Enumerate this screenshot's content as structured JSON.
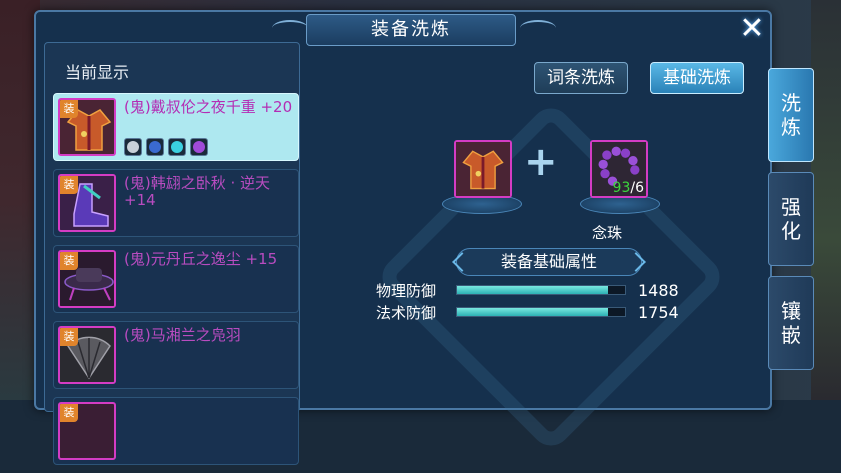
{
  "window": {
    "title": "装备洗炼",
    "close_label": "✕"
  },
  "left_panel": {
    "heading": "当前显示",
    "items": [
      {
        "name": "(鬼)戴叔伦之夜千重 +20",
        "badge": "装",
        "selected": true,
        "gems": [
          "#c8d0d8",
          "#3a6ad0",
          "#3ad0e0",
          "#a04ad8"
        ]
      },
      {
        "name": "(鬼)韩翃之卧秋 · 逆天 +14",
        "badge": "装",
        "selected": false
      },
      {
        "name": "(鬼)元丹丘之逸尘 +15",
        "badge": "装",
        "selected": false
      },
      {
        "name": "(鬼)马湘兰之凫羽",
        "badge": "装",
        "selected": false
      },
      {
        "name": "",
        "badge": "装",
        "selected": false
      }
    ]
  },
  "main": {
    "tab_words": "词条洗炼",
    "tab_base": "基础洗炼",
    "material": {
      "name": "念珠",
      "count_current": "93",
      "count_required": "/6"
    },
    "attr_title": "装备基础属性",
    "stats": [
      {
        "label": "物理防御",
        "value": "1488",
        "fill": 0.9
      },
      {
        "label": "法术防御",
        "value": "1754",
        "fill": 0.9
      }
    ]
  },
  "side_tabs": [
    {
      "label_top": "洗",
      "label_bottom": "炼",
      "active": true
    },
    {
      "label_top": "强",
      "label_bottom": "化",
      "active": false
    },
    {
      "label_top": "镶",
      "label_bottom": "嵌",
      "active": false
    }
  ]
}
